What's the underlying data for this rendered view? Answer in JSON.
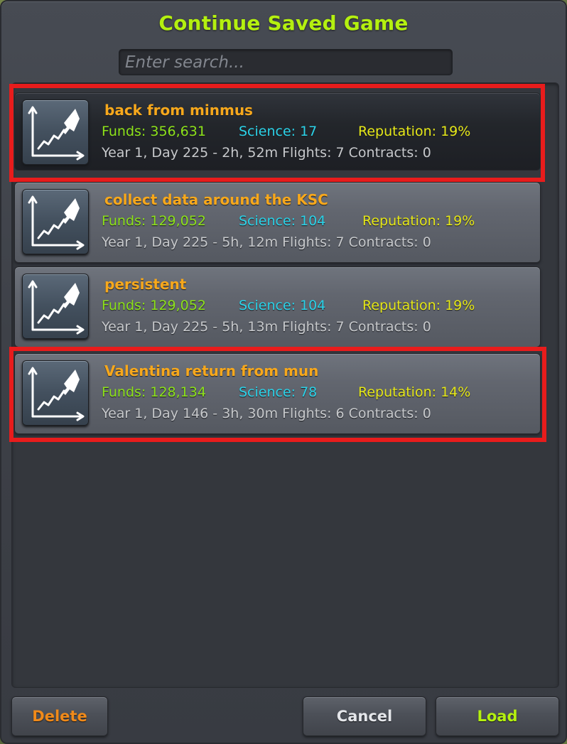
{
  "dialog": {
    "title": "Continue Saved Game",
    "search": {
      "placeholder": "Enter search...",
      "value": ""
    }
  },
  "saves": [
    {
      "name": "back from minmus",
      "funds": "Funds: 356,631",
      "science": "Science: 17",
      "reputation": "Reputation: 19%",
      "meta": "Year 1, Day 225 - 2h, 52m Flights: 7 Contracts: 0",
      "selected": true,
      "icon": "career-progress-rocket-icon"
    },
    {
      "name": "collect data around the KSC",
      "funds": "Funds: 129,052",
      "science": "Science: 104",
      "reputation": "Reputation: 19%",
      "meta": "Year 1, Day 225 - 5h, 12m Flights: 7 Contracts: 0",
      "selected": false,
      "icon": "career-progress-rocket-icon"
    },
    {
      "name": "persistent",
      "funds": "Funds: 129,052",
      "science": "Science: 104",
      "reputation": "Reputation: 19%",
      "meta": "Year 1, Day 225 - 5h, 13m Flights: 7 Contracts: 0",
      "selected": false,
      "icon": "career-progress-rocket-icon"
    },
    {
      "name": "Valentina return from mun",
      "funds": "Funds: 128,134",
      "science": "Science: 78",
      "reputation": "Reputation: 14%",
      "meta": "Year 1, Day 146 - 3h, 30m Flights: 6 Contracts: 0",
      "selected": false,
      "icon": "career-progress-rocket-icon"
    }
  ],
  "buttons": {
    "delete": "Delete",
    "cancel": "Cancel",
    "load": "Load"
  },
  "colors": {
    "title": "#b4f010",
    "save_name": "#f7a81c",
    "funds": "#8de21a",
    "science": "#2bd2e8",
    "reputation": "#e6e818",
    "meta": "#c7c9cc",
    "highlight": "#e81c1c",
    "delete": "#f08a1a",
    "cancel": "#e4e6ea",
    "load": "#b4f010"
  }
}
